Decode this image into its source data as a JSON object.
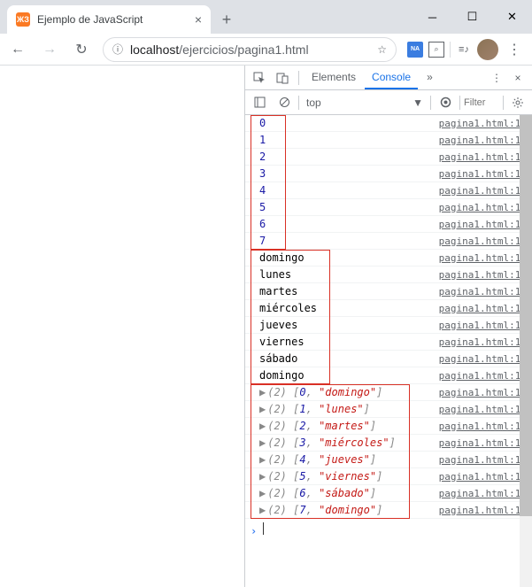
{
  "window": {
    "tab_title": "Ejemplo de JavaScript",
    "url_host": "localhost",
    "url_path": "/ejercicios/pagina1.html"
  },
  "devtools": {
    "tabs": {
      "elements": "Elements",
      "console": "Console",
      "more": "»"
    },
    "toolbar": {
      "context": "top",
      "filter_placeholder": "Filter"
    }
  },
  "console": {
    "group1": [
      {
        "value": "0",
        "src": "pagina1.html:13"
      },
      {
        "value": "1",
        "src": "pagina1.html:13"
      },
      {
        "value": "2",
        "src": "pagina1.html:13"
      },
      {
        "value": "3",
        "src": "pagina1.html:13"
      },
      {
        "value": "4",
        "src": "pagina1.html:13"
      },
      {
        "value": "5",
        "src": "pagina1.html:13"
      },
      {
        "value": "6",
        "src": "pagina1.html:13"
      },
      {
        "value": "7",
        "src": "pagina1.html:13"
      }
    ],
    "group2": [
      {
        "value": "domingo",
        "src": "pagina1.html:15"
      },
      {
        "value": "lunes",
        "src": "pagina1.html:15"
      },
      {
        "value": "martes",
        "src": "pagina1.html:15"
      },
      {
        "value": "miércoles",
        "src": "pagina1.html:15"
      },
      {
        "value": "jueves",
        "src": "pagina1.html:15"
      },
      {
        "value": "viernes",
        "src": "pagina1.html:15"
      },
      {
        "value": "sábado",
        "src": "pagina1.html:15"
      },
      {
        "value": "domingo",
        "src": "pagina1.html:15"
      }
    ],
    "group3": [
      {
        "len": "(2)",
        "idx": "0",
        "str": "\"domingo\"",
        "src": "pagina1.html:17"
      },
      {
        "len": "(2)",
        "idx": "1",
        "str": "\"lunes\"",
        "src": "pagina1.html:17"
      },
      {
        "len": "(2)",
        "idx": "2",
        "str": "\"martes\"",
        "src": "pagina1.html:17"
      },
      {
        "len": "(2)",
        "idx": "3",
        "str": "\"miércoles\"",
        "src": "pagina1.html:17"
      },
      {
        "len": "(2)",
        "idx": "4",
        "str": "\"jueves\"",
        "src": "pagina1.html:17"
      },
      {
        "len": "(2)",
        "idx": "5",
        "str": "\"viernes\"",
        "src": "pagina1.html:17"
      },
      {
        "len": "(2)",
        "idx": "6",
        "str": "\"sábado\"",
        "src": "pagina1.html:17"
      },
      {
        "len": "(2)",
        "idx": "7",
        "str": "\"domingo\"",
        "src": "pagina1.html:17"
      }
    ]
  }
}
